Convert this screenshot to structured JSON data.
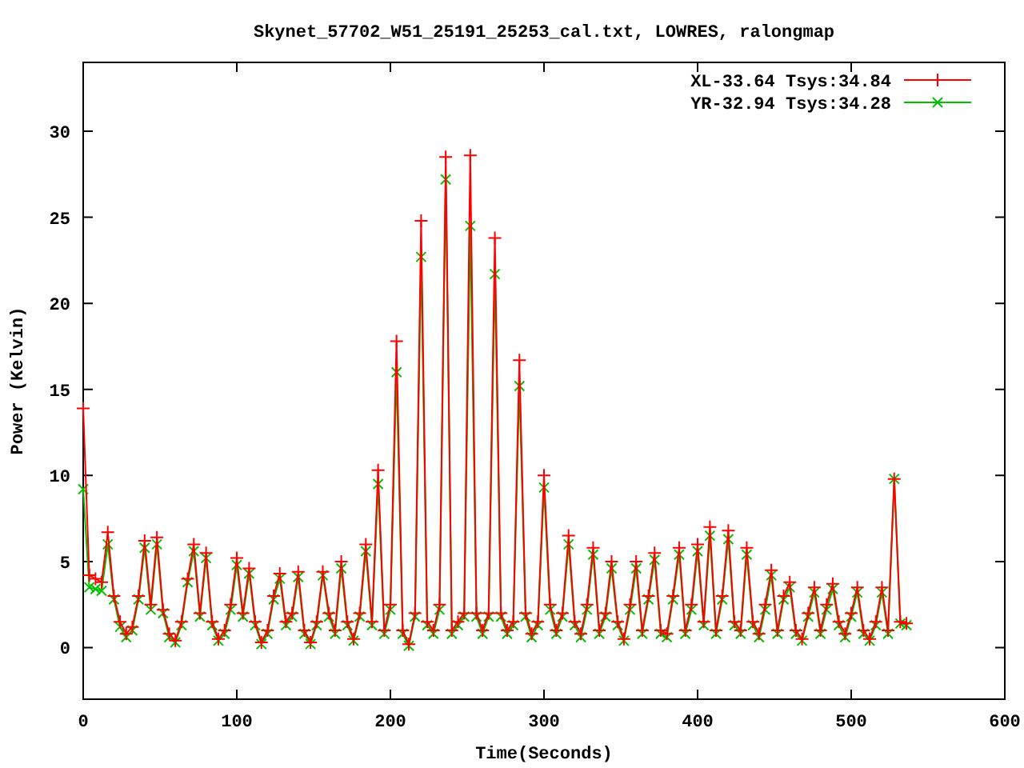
{
  "chart_data": {
    "type": "line",
    "title": "Skynet_57702_W51_25191_25253_cal.txt, LOWRES, ralongmap",
    "xlabel": "Time(Seconds)",
    "ylabel": "Power (Kelvin)",
    "x": [
      0,
      4,
      8,
      12,
      16,
      20,
      24,
      28,
      32,
      36,
      40,
      44,
      48,
      52,
      56,
      60,
      64,
      68,
      72,
      76,
      80,
      84,
      88,
      92,
      96,
      100,
      104,
      108,
      112,
      116,
      120,
      124,
      128,
      132,
      136,
      140,
      144,
      148,
      152,
      156,
      160,
      164,
      168,
      172,
      176,
      180,
      184,
      188,
      192,
      196,
      200,
      204,
      208,
      212,
      216,
      220,
      224,
      228,
      232,
      236,
      240,
      244,
      248,
      252,
      256,
      260,
      264,
      268,
      272,
      276,
      280,
      284,
      288,
      292,
      296,
      300,
      304,
      308,
      312,
      316,
      320,
      324,
      328,
      332,
      336,
      340,
      344,
      348,
      352,
      356,
      360,
      364,
      368,
      372,
      376,
      380,
      384,
      388,
      392,
      396,
      400,
      404,
      408,
      412,
      416,
      420,
      424,
      428,
      432,
      436,
      440,
      444,
      448,
      452,
      456,
      460,
      464,
      468,
      472,
      476,
      480,
      484,
      488,
      492,
      496,
      500,
      504,
      508,
      512,
      516,
      520,
      524,
      528,
      532,
      536
    ],
    "series": [
      {
        "name": "XL-33.64 Tsys:34.84",
        "color": "#ff0000",
        "marker": "plus",
        "values": [
          13.9,
          4.2,
          4.0,
          3.8,
          6.7,
          3.0,
          1.5,
          0.8,
          1.2,
          3.0,
          6.2,
          2.5,
          6.4,
          2.2,
          0.8,
          0.4,
          1.5,
          4.0,
          6.0,
          2.0,
          5.5,
          1.5,
          0.5,
          1.0,
          2.5,
          5.2,
          2.0,
          4.6,
          1.5,
          0.3,
          1.0,
          3.0,
          4.3,
          1.5,
          2.0,
          4.4,
          1.0,
          0.3,
          1.5,
          4.4,
          2.0,
          1.0,
          5.0,
          1.5,
          0.5,
          2.0,
          6.0,
          1.5,
          10.3,
          1.0,
          2.5,
          17.8,
          1.0,
          0.2,
          2.0,
          24.8,
          1.5,
          1.0,
          2.5,
          28.5,
          1.0,
          1.5,
          2.0,
          28.6,
          2.0,
          1.0,
          2.0,
          23.8,
          2.0,
          1.0,
          1.5,
          16.7,
          2.0,
          0.8,
          1.5,
          10.0,
          2.5,
          1.0,
          2.0,
          6.5,
          1.5,
          0.8,
          2.5,
          5.8,
          1.0,
          2.0,
          5.0,
          1.5,
          0.5,
          2.5,
          5.0,
          1.0,
          3.0,
          5.5,
          1.0,
          0.8,
          3.0,
          5.8,
          1.0,
          2.5,
          6.0,
          1.5,
          7.0,
          1.0,
          3.0,
          6.8,
          1.5,
          1.0,
          5.8,
          1.5,
          0.8,
          2.5,
          4.5,
          1.0,
          3.0,
          3.8,
          1.0,
          0.5,
          2.0,
          3.5,
          1.0,
          2.5,
          3.7,
          1.5,
          0.8,
          2.0,
          3.5,
          1.0,
          0.5,
          1.5,
          3.5,
          1.0,
          9.8,
          1.5,
          1.4
        ]
      },
      {
        "name": "YR-32.94 Tsys:34.28",
        "color": "#00c000",
        "marker": "x",
        "values": [
          9.2,
          3.5,
          3.4,
          3.3,
          6.0,
          2.8,
          1.2,
          0.6,
          1.0,
          2.8,
          5.8,
          2.2,
          6.0,
          2.0,
          0.6,
          0.3,
          1.3,
          3.8,
          5.6,
          1.8,
          5.2,
          1.3,
          0.4,
          0.8,
          2.2,
          4.8,
          1.8,
          4.3,
          1.3,
          0.2,
          0.8,
          2.8,
          4.0,
          1.3,
          1.8,
          4.1,
          0.8,
          0.2,
          1.3,
          4.2,
          1.8,
          0.8,
          4.6,
          1.3,
          0.4,
          1.8,
          5.6,
          1.3,
          9.5,
          0.8,
          2.2,
          16.0,
          0.8,
          0.1,
          1.8,
          22.7,
          1.3,
          0.8,
          2.2,
          27.2,
          0.8,
          1.3,
          1.8,
          24.5,
          1.8,
          0.8,
          1.8,
          21.7,
          1.8,
          0.8,
          1.3,
          15.2,
          1.8,
          0.6,
          1.3,
          9.3,
          2.2,
          0.8,
          1.8,
          6.0,
          1.3,
          0.6,
          2.2,
          5.4,
          0.8,
          1.8,
          4.6,
          1.3,
          0.4,
          2.2,
          4.6,
          0.8,
          2.8,
          5.1,
          0.8,
          0.6,
          2.8,
          5.4,
          0.8,
          2.2,
          5.6,
          1.3,
          6.5,
          0.8,
          2.8,
          6.3,
          1.3,
          0.8,
          5.4,
          1.3,
          0.6,
          2.2,
          4.2,
          0.8,
          2.8,
          3.5,
          0.8,
          0.4,
          1.8,
          3.2,
          0.8,
          2.2,
          3.4,
          1.3,
          0.6,
          1.8,
          3.2,
          0.8,
          0.4,
          1.3,
          3.2,
          0.8,
          9.8,
          1.4,
          1.3
        ]
      }
    ],
    "legend": true,
    "xlim": [
      0,
      600
    ],
    "ylim": [
      -3,
      34
    ],
    "xticks": [
      0,
      100,
      200,
      300,
      400,
      500,
      600
    ],
    "yticks": [
      0,
      5,
      10,
      15,
      20,
      25,
      30
    ]
  }
}
